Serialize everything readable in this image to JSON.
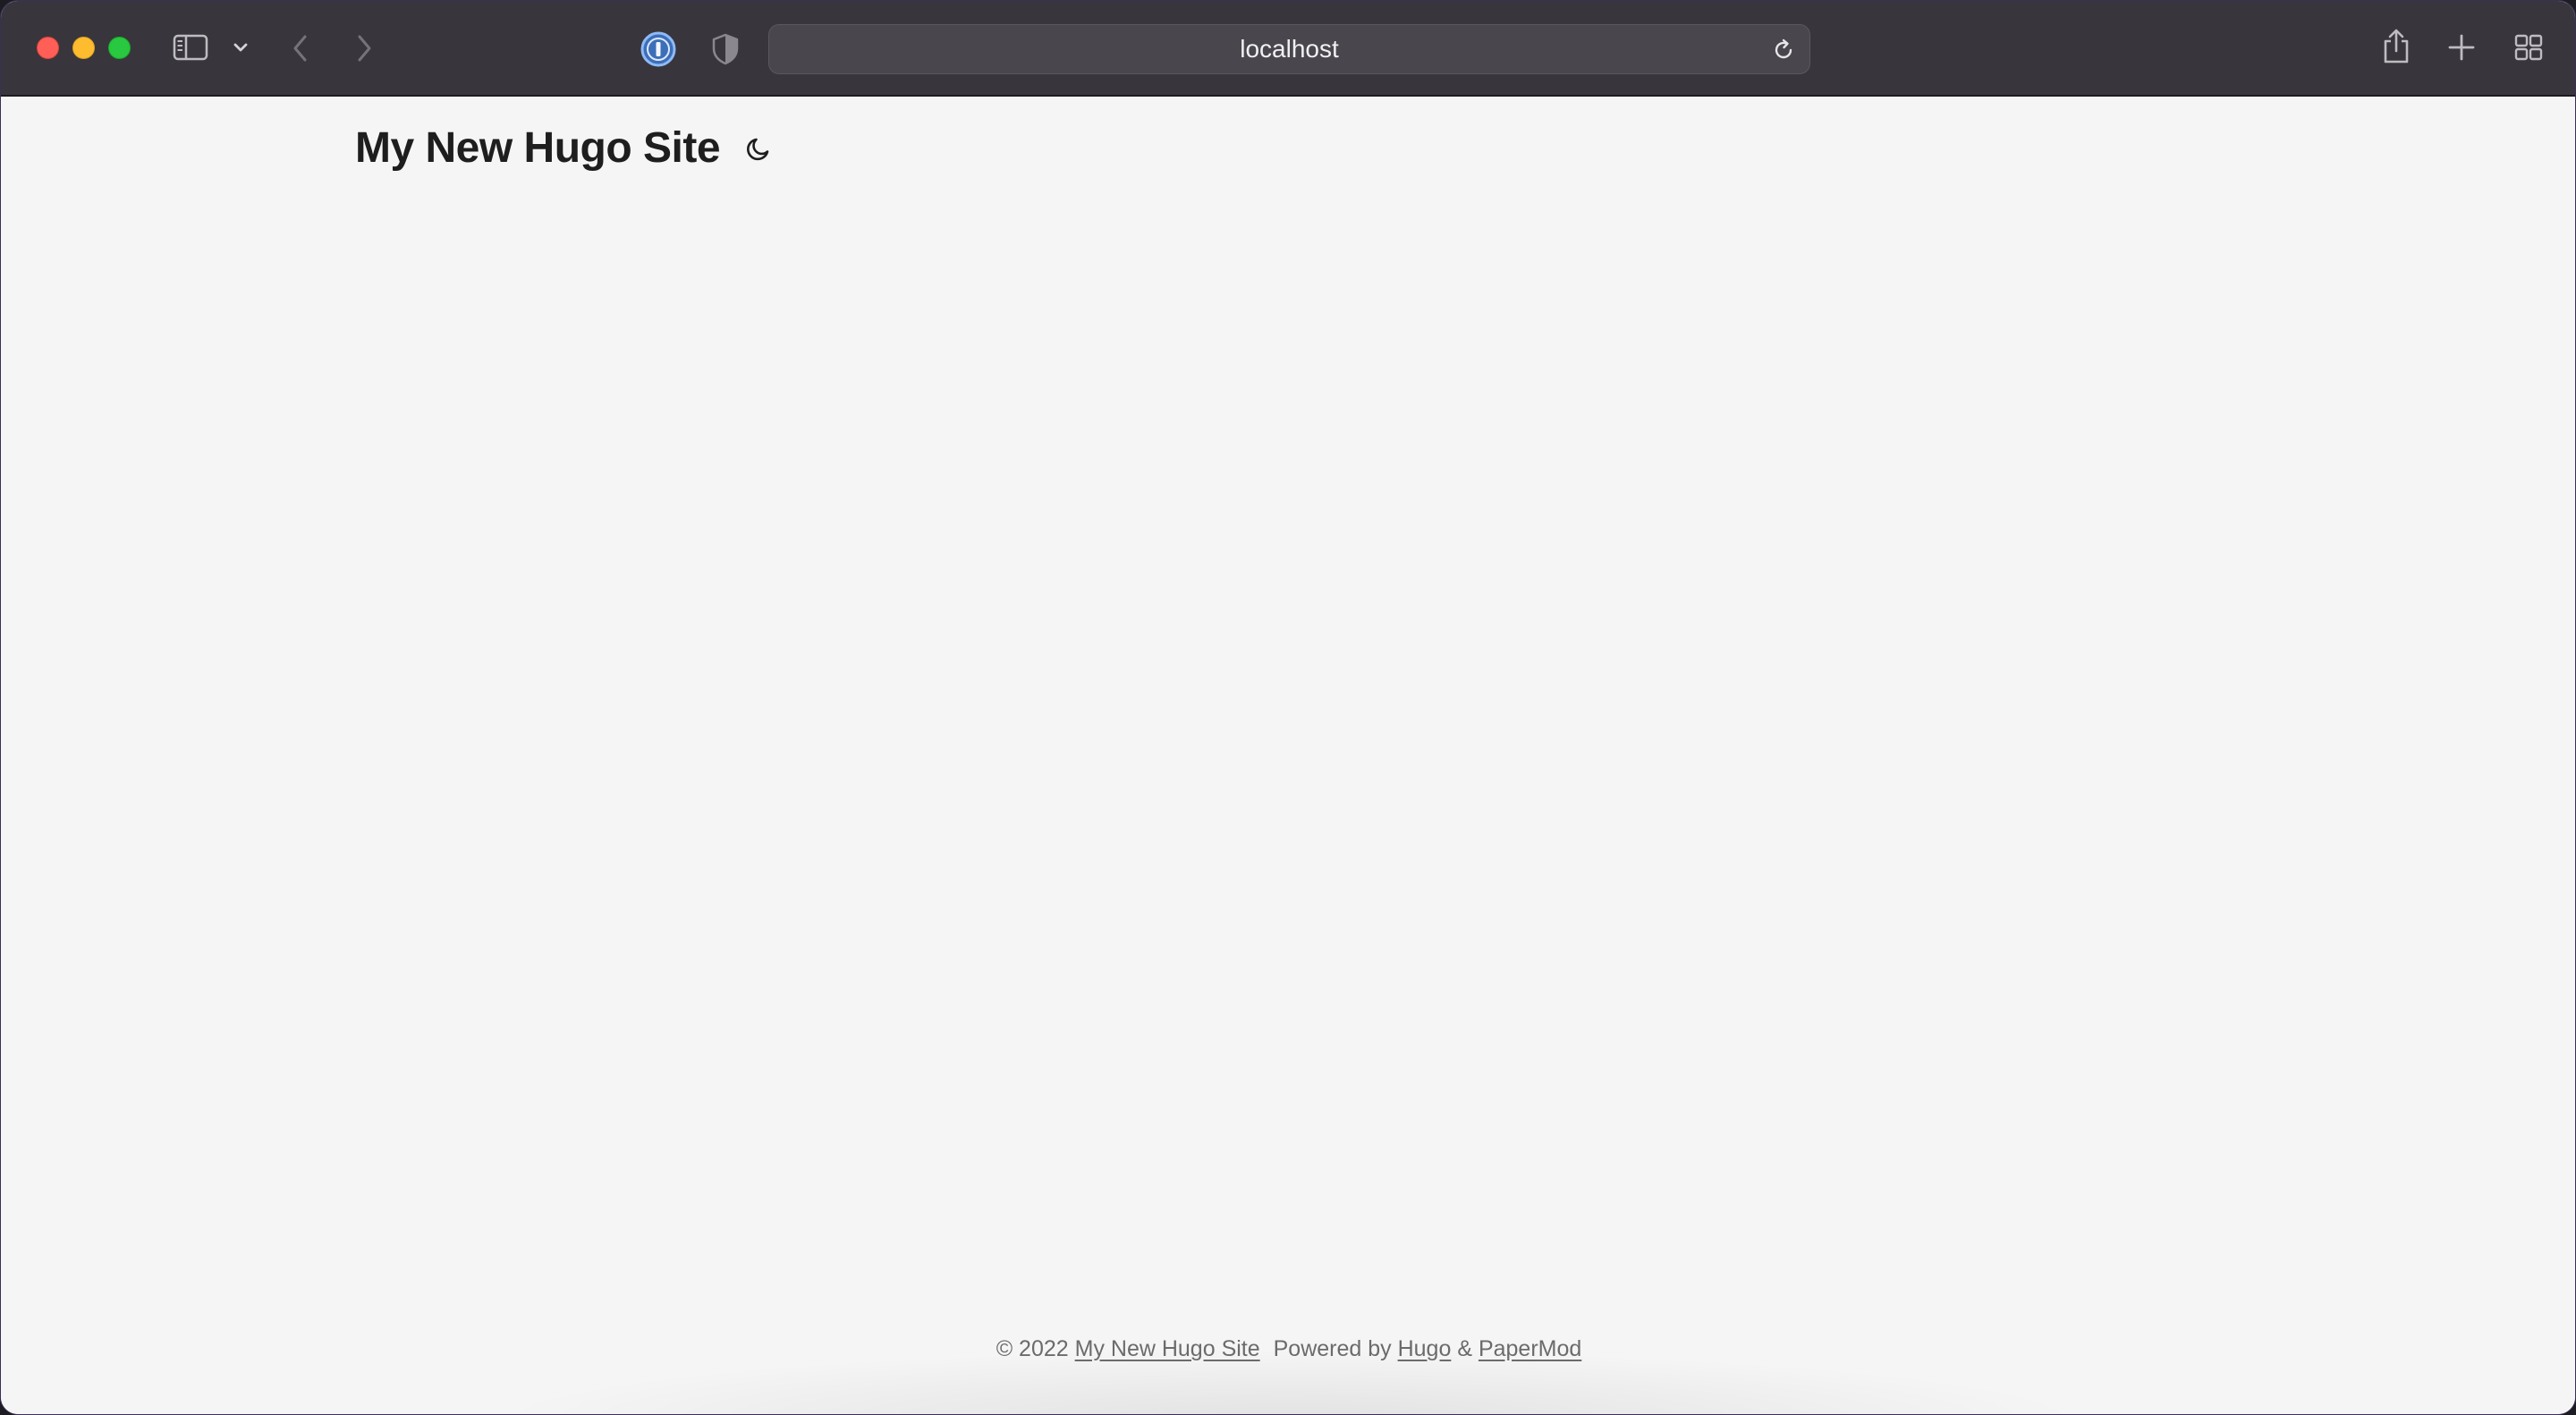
{
  "browser": {
    "address": "localhost",
    "icons": {
      "close": "red-circle",
      "minimize": "yellow-circle",
      "zoom": "green-circle",
      "sidebar": "sidebar-icon",
      "sidebar_menu": "chevron-down-icon",
      "back": "chevron-left-icon",
      "forward": "chevron-right-icon",
      "password_manager": "onepassword-icon",
      "privacy": "shield-icon",
      "reload": "reload-icon",
      "share": "share-icon",
      "new_tab": "plus-icon",
      "tab_overview": "grid-icon"
    },
    "colors": {
      "toolbar": "#38363c",
      "address_bar": "#49474d",
      "accent_blue": "#5a9cf5"
    }
  },
  "site": {
    "title": "My New Hugo Site",
    "theme_toggle_icon": "moon-icon"
  },
  "footer": {
    "copyright": "© 2022",
    "site_link": "My New Hugo Site",
    "powered_by": "Powered by",
    "hugo_link": "Hugo",
    "ampersand": "&",
    "theme_link": "PaperMod"
  }
}
